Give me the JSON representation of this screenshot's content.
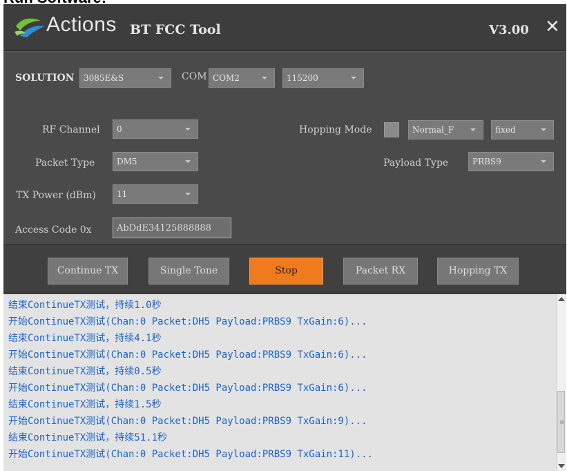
{
  "caption": "Run Software:",
  "window": {
    "brand": "Actions",
    "title": "BT FCC Tool",
    "version": "V3.00",
    "close_icon": "close-icon"
  },
  "connection": {
    "solution_label": "SOLUTION",
    "solution_value": "3085E&S",
    "com_label": "COM",
    "com_value": "COM2",
    "baud_value": "115200"
  },
  "settings": {
    "rf_channel_label": "RF Channel",
    "rf_channel_value": "0",
    "packet_type_label": "Packet Type",
    "packet_type_value": "DM5",
    "tx_power_label": "TX Power (dBm)",
    "tx_power_value": "11",
    "access_code_label": "Access Code 0x",
    "access_code_value": "AbDdE34125888888",
    "hopping_mode_label": "Hopping Mode",
    "hopping_mode_checked": false,
    "hopping_mode_value": "Normal_F",
    "hopping_freq_value": "fixed",
    "payload_type_label": "Payload Type",
    "payload_type_value": "PRBS9"
  },
  "actions": {
    "continue_tx": "Continue TX",
    "single_tone": "Single Tone",
    "stop": "Stop",
    "packet_rx": "Packet RX",
    "hopping_tx": "Hopping TX"
  },
  "colors": {
    "accent": "#f07b1e",
    "log_text": "#1b63c9",
    "logo_green": "#6fc23a",
    "logo_blue": "#2c8fd6"
  },
  "log": [
    "结束ContinueTX测试，持续1.0秒",
    "开始ContinueTX测试(Chan:0 Packet:DH5 Payload:PRBS9 TxGain:6)...",
    "结束ContinueTX测试，持续4.1秒",
    "开始ContinueTX测试(Chan:0 Packet:DH5 Payload:PRBS9 TxGain:6)...",
    "结束ContinueTX测试，持续0.5秒",
    "开始ContinueTX测试(Chan:0 Packet:DH5 Payload:PRBS9 TxGain:6)...",
    "结束ContinueTX测试，持续1.5秒",
    "开始ContinueTX测试(Chan:0 Packet:DH5 Payload:PRBS9 TxGain:9)...",
    "结束ContinueTX测试，持续51.1秒",
    "开始ContinueTX测试(Chan:0 Packet:DH5 Payload:PRBS9 TxGain:11)..."
  ]
}
